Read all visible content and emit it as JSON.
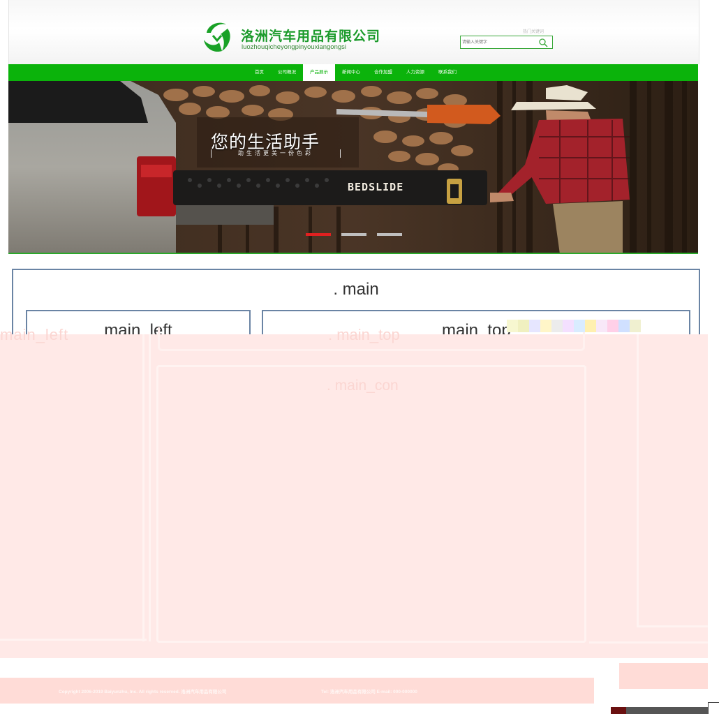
{
  "header": {
    "company_name": "洛洲汽车用品有限公司",
    "company_pinyin": "luozhouqicheyongpinyouxiangongsi",
    "search_tip": "热门关键词",
    "search_placeholder": "请输入关键字"
  },
  "nav": {
    "items": [
      {
        "label": "首页"
      },
      {
        "label": "公司概况"
      },
      {
        "label": "产品展示",
        "active": true
      },
      {
        "label": "新闻中心"
      },
      {
        "label": "合作加盟"
      },
      {
        "label": "人力资源"
      },
      {
        "label": "联系我们"
      }
    ]
  },
  "banner": {
    "title": "您的生活助手",
    "subtitle": "助生活更美一份色彩",
    "brand": "BEDSLIDE",
    "slides": 3,
    "active_slide": 1
  },
  "layout": {
    "main_label": ". main",
    "main_left_label": "main_left",
    "main_top_label": "main_top",
    "overlay_left_label": "main_left",
    "overlay_top_label": ". main_top",
    "overlay_con_label": ". main_con"
  },
  "footer": {
    "copyright": "Copyright 2006-2019 Baiyunzhu, Inc. All rights reserved. 洛洲汽车用品有限公司",
    "contact": "Tel: 洛洲汽车用品有限公司 E-mail: 000-000000"
  },
  "colors": {
    "brand_green": "#0bb30b",
    "active_dot": "#e02020"
  }
}
